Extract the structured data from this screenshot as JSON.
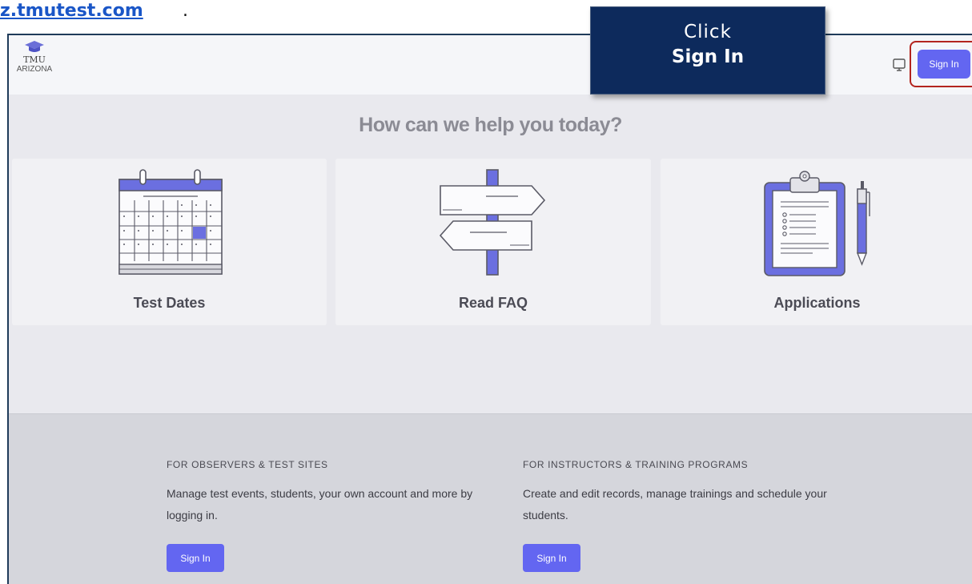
{
  "url": {
    "text": "z.tmutest.com",
    "suffix": "."
  },
  "header": {
    "logo_line1": "TMU",
    "logo_line2": "ARIZONA",
    "signin_label": "Sign In",
    "monitor_icon": "monitor-icon"
  },
  "callout": {
    "line1": "Click",
    "line2": "Sign In"
  },
  "main": {
    "headline": "How can we help you today?",
    "cards": [
      {
        "label": "Test Dates",
        "icon": "calendar-icon"
      },
      {
        "label": "Read FAQ",
        "icon": "signpost-icon"
      },
      {
        "label": "Applications",
        "icon": "clipboard-icon"
      }
    ]
  },
  "footer": {
    "observers": {
      "heading": "FOR OBSERVERS & TEST SITES",
      "text": "Manage test events, students, your own account and more by logging in.",
      "button": "Sign In"
    },
    "instructors": {
      "heading": "FOR INSTRUCTORS & TRAINING PROGRAMS",
      "text": "Create and edit records, manage trainings and schedule your students.",
      "button": "Sign In"
    }
  },
  "colors": {
    "accent": "#6366f1",
    "callout_bg": "#0d2a5c",
    "highlight": "#b3241e",
    "link": "#1a56c7"
  }
}
